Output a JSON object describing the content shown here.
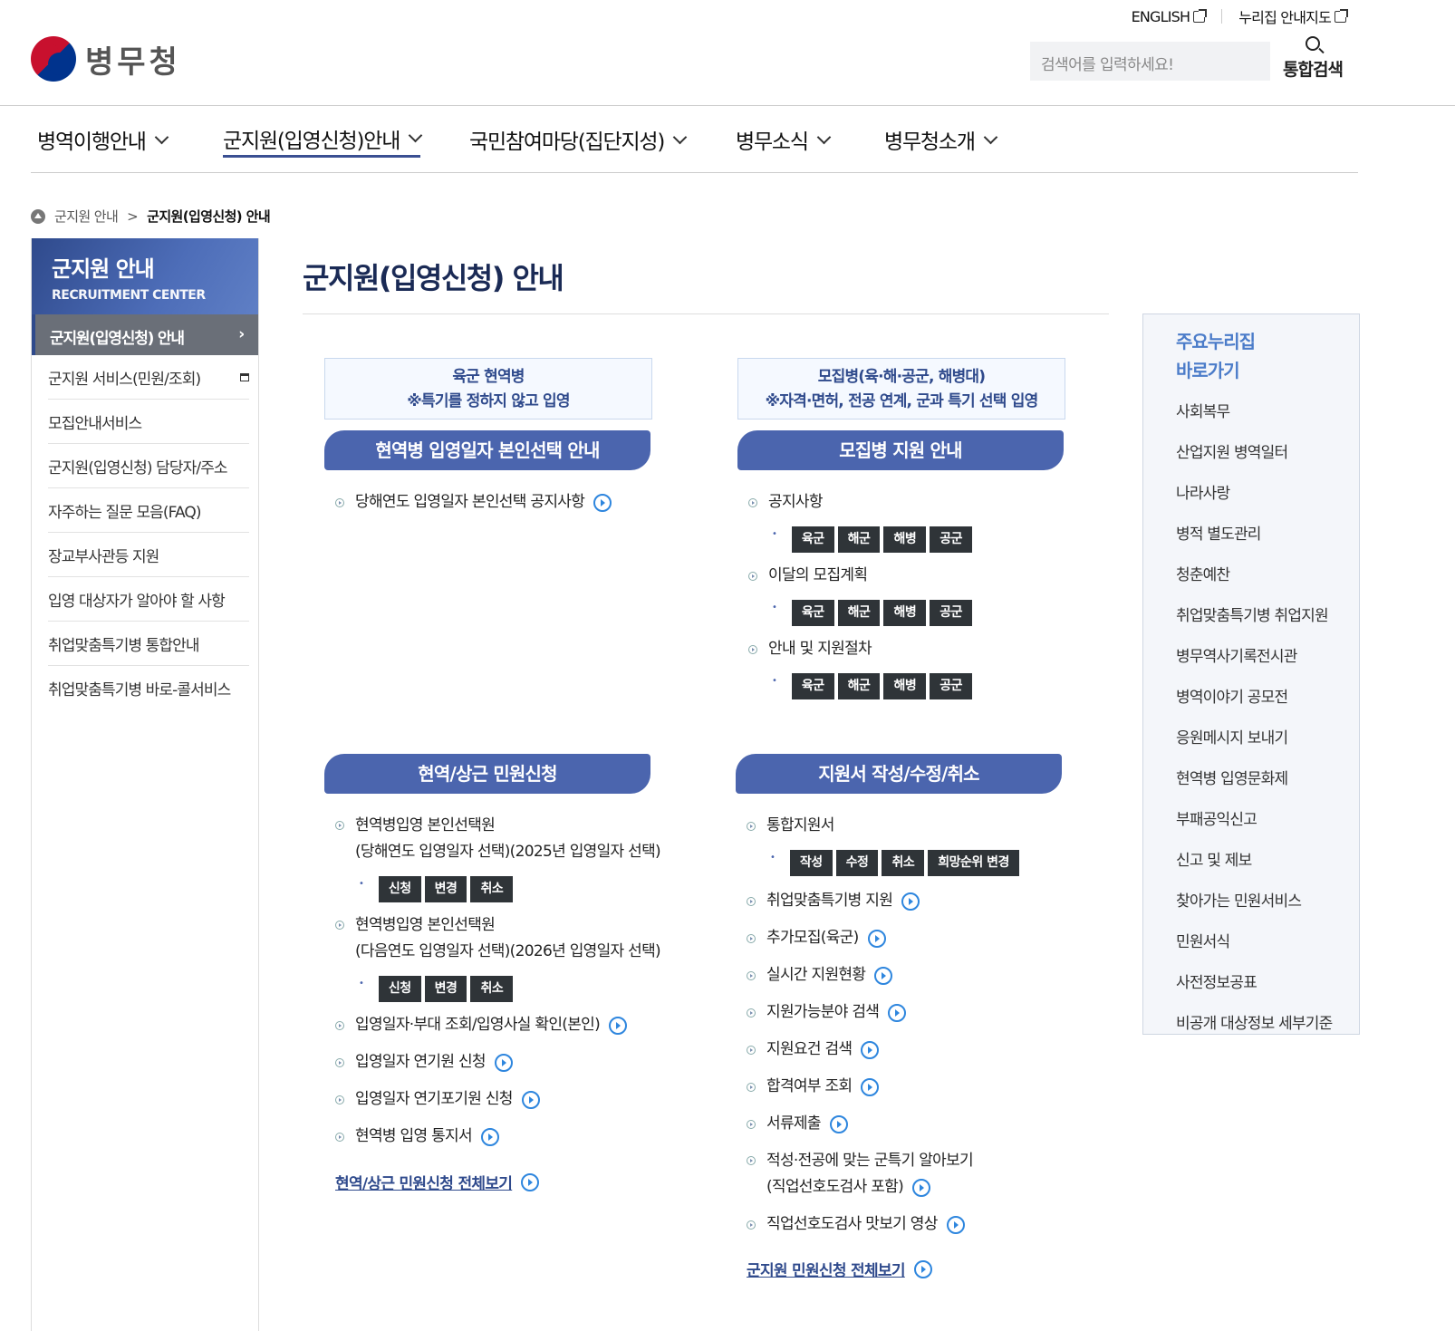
{
  "util": {
    "english": "ENGLISH",
    "sitemap": "누리집 안내지도"
  },
  "logo": {
    "text": "병무청"
  },
  "search": {
    "placeholder": "검색어를 입력하세요!",
    "button": "통합검색"
  },
  "gnb": [
    "병역이행안내",
    "군지원(입영신청)안내",
    "국민참여마당(집단지성)",
    "병무소식",
    "병무청소개"
  ],
  "breadcrumb": {
    "parent": "군지원 안내",
    "sep": ">",
    "current": "군지원(입영신청) 안내"
  },
  "lnb": {
    "title": "군지원 안내",
    "subtitle": "RECRUITMENT CENTER",
    "current": "군지원(입영신청) 안내",
    "items": [
      "군지원 서비스(민원/조회)",
      "모집안내서비스",
      "군지원(입영신청) 담당자/주소",
      "자주하는 질문 모음(FAQ)",
      "장교부사관등 지원",
      "입영 대상자가 알아야 할 사항",
      "취업맞춤특기병 통합안내",
      "취업맞춤특기병 바로-콜서비스"
    ]
  },
  "page_title": "군지원(입영신청) 안내",
  "army": {
    "box_line1": "육군 현역병",
    "box_line2": "※특기를 정하지 않고 입영",
    "pill": "현역병 입영일자 본인선택 안내",
    "notice": "당해연도 입영일자 본인선택 공지사항"
  },
  "recruit": {
    "box_line1": "모집병(육·해·공군, 해병대)",
    "box_line2": "※자격·면허, 전공 연계, 군과 특기 선택 입영",
    "pill": "모집병 지원 안내",
    "groups": [
      {
        "label": "공지사항",
        "chips": [
          "육군",
          "해군",
          "해병",
          "공군"
        ]
      },
      {
        "label": "이달의 모집계획",
        "chips": [
          "육군",
          "해군",
          "해병",
          "공군"
        ]
      },
      {
        "label": "안내 및 지원절차",
        "chips": [
          "육군",
          "해군",
          "해병",
          "공군"
        ]
      }
    ]
  },
  "civil": {
    "pill": "현역/상근 민원신청",
    "sel1": {
      "line1": "현역병입영 본인선택원",
      "line2": "(당해연도 입영일자 선택)(2025년 입영일자 선택)",
      "chips": [
        "신청",
        "변경",
        "취소"
      ]
    },
    "sel2": {
      "line1": "현역병입영 본인선택원",
      "line2": "(다음연도 입영일자 선택)(2026년 입영일자 선택)",
      "chips": [
        "신청",
        "변경",
        "취소"
      ]
    },
    "links": [
      "입영일자·부대 조회/입영사실 확인(본인)",
      "입영일자 연기원 신청",
      "입영일자 연기포기원 신청",
      "현역병 입영 통지서"
    ],
    "more": "현역/상근 민원신청 전체보기"
  },
  "apply": {
    "pill": "지원서 작성/수정/취소",
    "combined": {
      "label": "통합지원서",
      "chips": [
        "작성",
        "수정",
        "취소",
        "희망순위 변경"
      ]
    },
    "links": [
      "취업맞춤특기병 지원",
      "추가모집(육군)",
      "실시간 지원현황",
      "지원가능분야 검색",
      "지원요건 검색",
      "합격여부 조회",
      "서류제출"
    ],
    "aptitude": {
      "line1": "적성·전공에 맞는 군특기 알아보기",
      "line2": "(직업선호도검사 포함)"
    },
    "preview": "직업선호도검사 맛보기 영상",
    "more": "군지원 민원신청 전체보기"
  },
  "side": {
    "title1": "주요누리집",
    "title2": "바로가기",
    "items": [
      "사회복무",
      "산업지원 병역일터",
      "나라사랑",
      "병적 별도관리",
      "청춘예찬",
      "취업맞춤특기병 취업지원",
      "병무역사기록전시관",
      "병역이야기 공모전",
      "응원메시지 보내기",
      "현역병 입영문화제",
      "부패공익신고",
      "신고 및 제보",
      "찾아가는 민원서비스",
      "민원서식",
      "사전정보공표",
      "비공개 대상정보 세부기준"
    ]
  }
}
